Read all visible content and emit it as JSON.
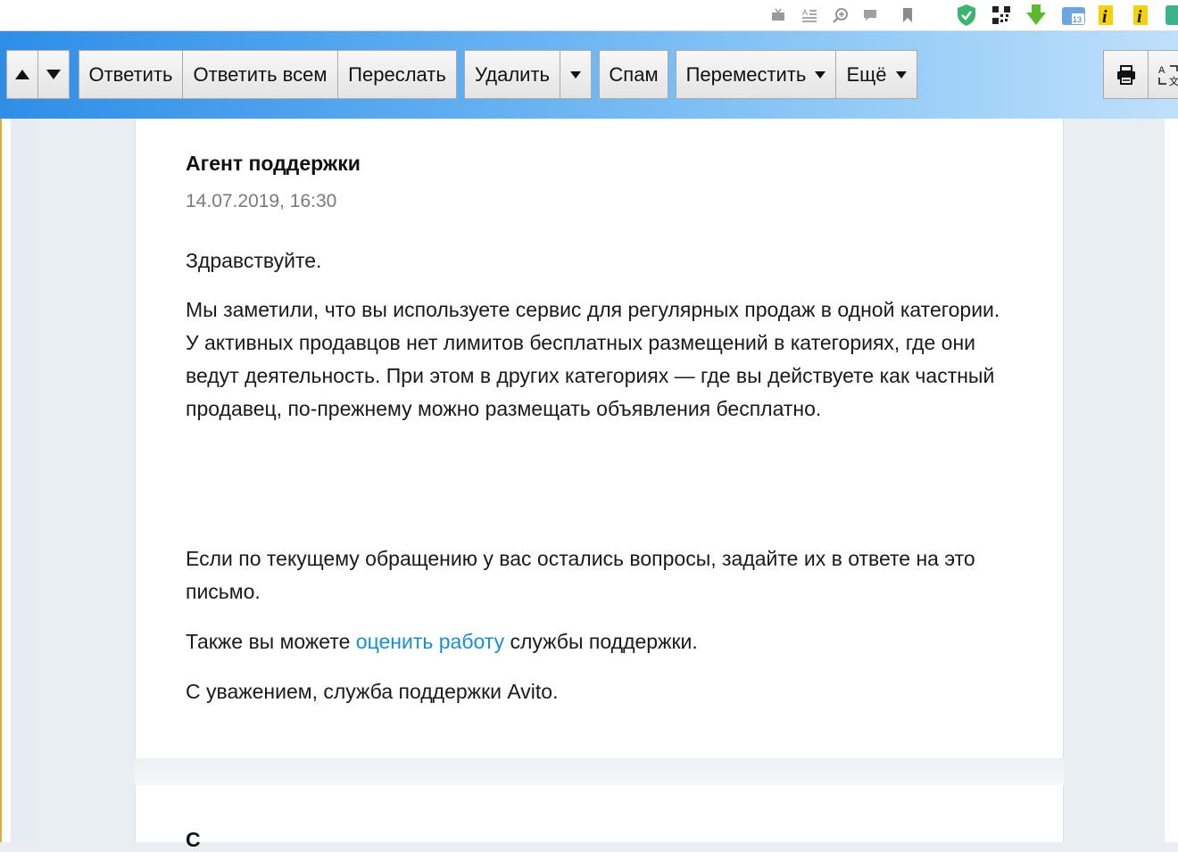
{
  "toolbar": {
    "reply": "Ответить",
    "reply_all": "Ответить всем",
    "forward": "Переслать",
    "delete": "Удалить",
    "spam": "Спам",
    "move": "Переместить",
    "more": "Ещё"
  },
  "message": {
    "sender": "Агент поддержки",
    "date": "14.07.2019, 16:30",
    "greeting": "Здравствуйте.",
    "body": "Мы заметили, что вы используете сервис для регулярных продаж в одной категории. У активных продавцов нет лимитов бесплатных размещений в категориях, где они ведут деятельность. При этом в других категориях — где вы действуете как частный продавец, по-прежнему можно размещать объявления бесплатно.",
    "questions": "Если по текущему обращению у вас остались вопросы, задайте их в ответе на это письмо.",
    "rate_prefix": "Также вы можете ",
    "rate_link": "оценить работу",
    "rate_suffix": " службы поддержки.",
    "signature": "С уважением, служба поддержки Avito."
  },
  "next_message": {
    "sender_partial": "С"
  },
  "colors": {
    "link": "#1a8fd0",
    "toolbar_gradient_start": "#2e8ee6",
    "toolbar_gradient_end": "#bfe0fb"
  }
}
